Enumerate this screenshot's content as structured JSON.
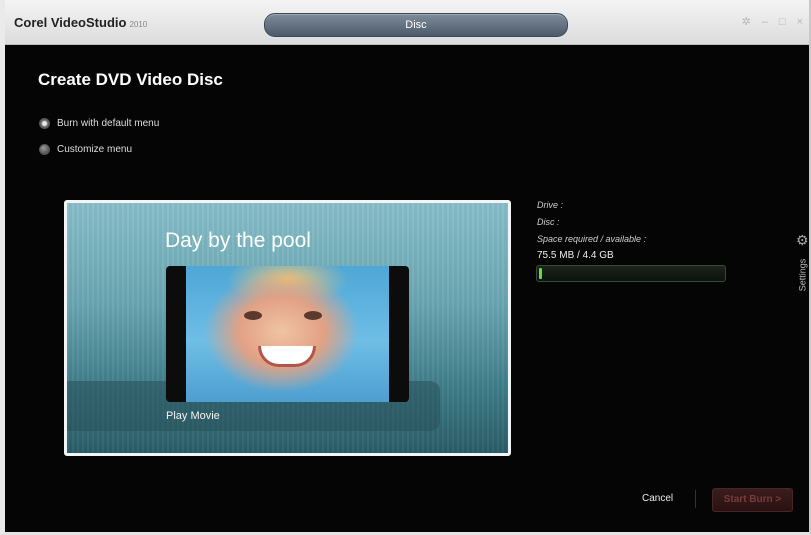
{
  "app": {
    "title": "Corel VideoStudio",
    "version": "2010",
    "mode": "Disc"
  },
  "window_controls": {
    "settings_glyph": "✲",
    "minimize_glyph": "–",
    "maximize_glyph": "□",
    "close_glyph": "×"
  },
  "page": {
    "heading": "Create DVD Video Disc"
  },
  "options": [
    {
      "label": "Burn with default menu",
      "selected": true
    },
    {
      "label": "Customize menu",
      "selected": false
    }
  ],
  "preview": {
    "title": "Day by the pool",
    "menu_item": "Play Movie"
  },
  "disc_info": {
    "drive_label": "Drive :",
    "disc_label": "Disc :",
    "space_label": "Space required / available :",
    "space_value": "75.5 MB / 4.4 GB",
    "usage_fraction": 0.017
  },
  "side_panel": {
    "settings_label": "Settings",
    "gear_glyph": "⚙"
  },
  "footer": {
    "cancel_label": "Cancel",
    "start_label": "Start Burn >"
  },
  "colors": {
    "progress_fill": "#5fe03a",
    "pill": "#5a6878"
  }
}
